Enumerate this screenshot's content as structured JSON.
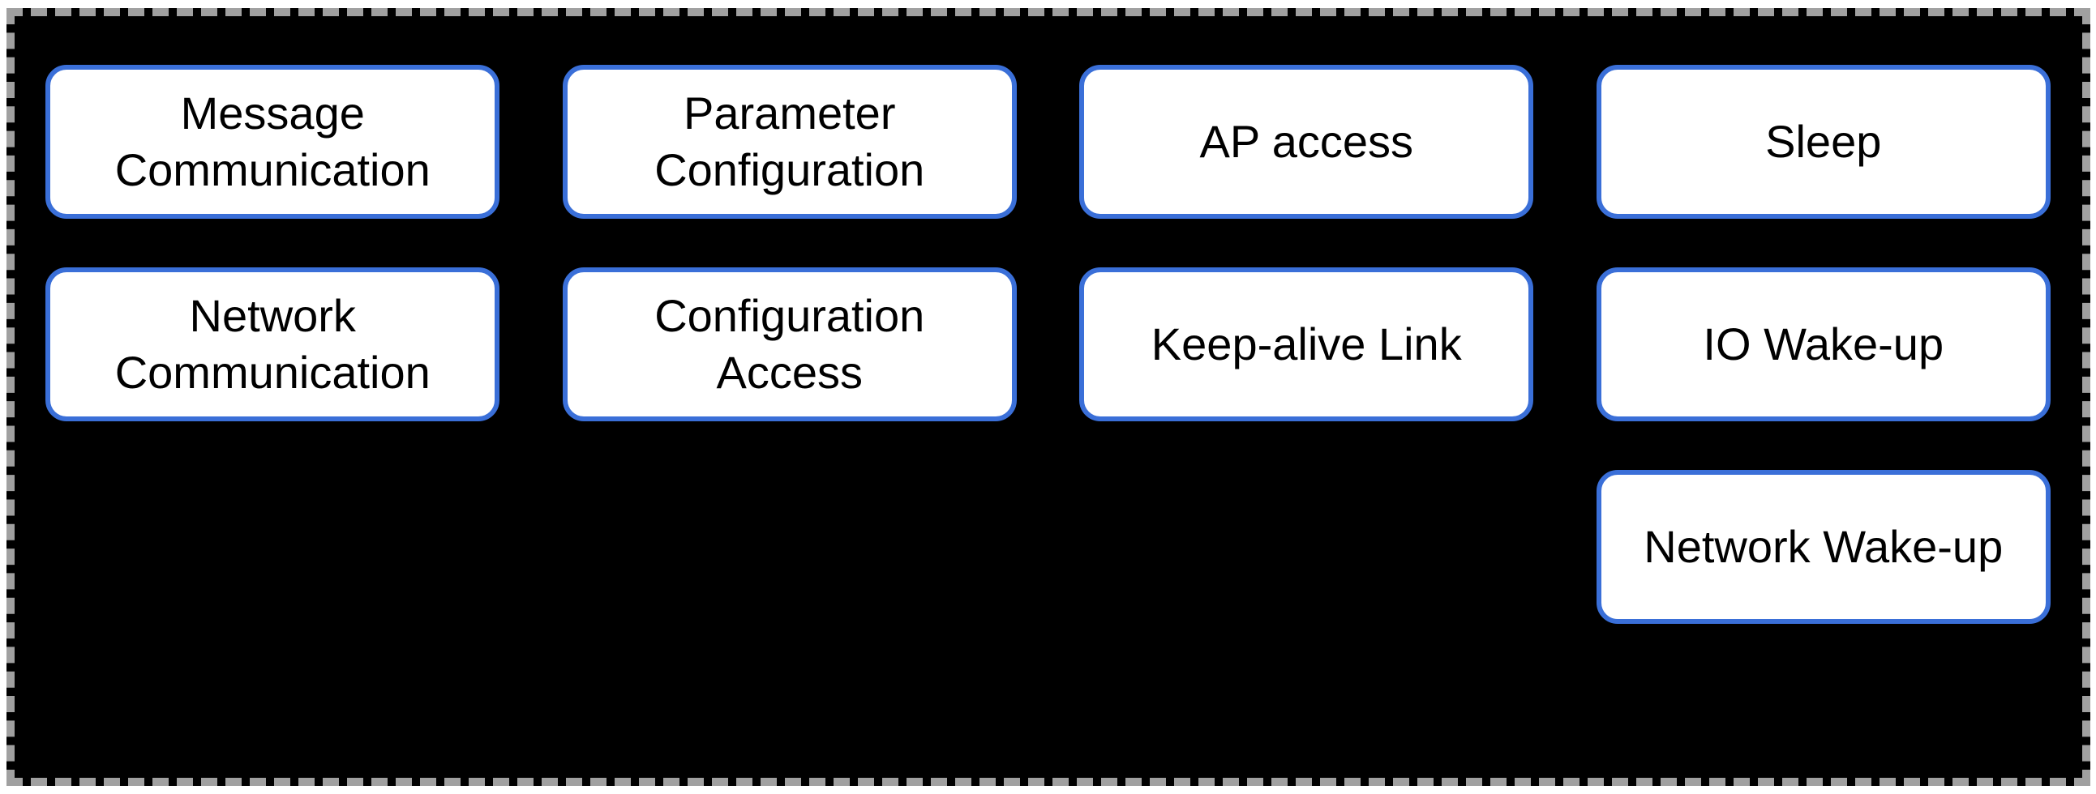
{
  "boxes": {
    "r0c0": "Message Communication",
    "r0c1": "Parameter Configuration",
    "r0c2": "AP access",
    "r0c3": "Sleep",
    "r1c0": "Network Communication",
    "r1c1": "Configuration Access",
    "r1c2": "Keep-alive Link",
    "r1c3": "IO Wake-up",
    "r2c3": "Network Wake-up"
  }
}
